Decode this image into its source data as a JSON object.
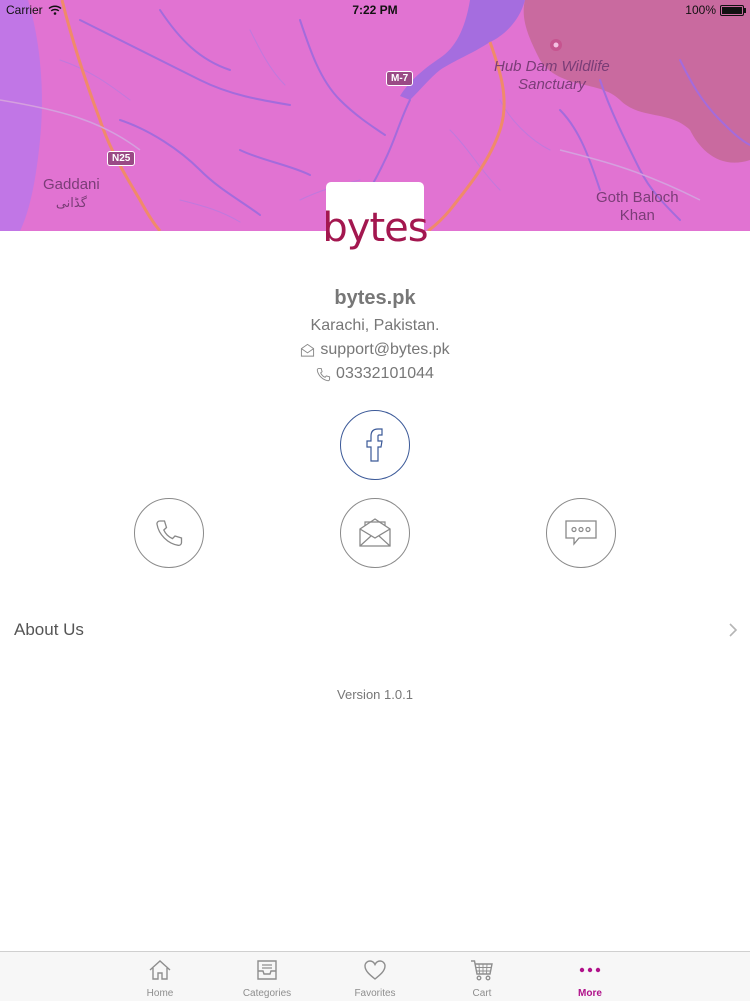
{
  "status_bar": {
    "carrier": "Carrier",
    "time": "7:22 PM",
    "battery": "100%"
  },
  "map": {
    "labels": {
      "gaddani": "Gaddani",
      "gaddani_urdu": "گڈانی",
      "hub_dam_line1": "Hub Dam Wildlife",
      "hub_dam_line2": "Sanctuary",
      "goth_line1": "Goth Baloch",
      "goth_line2": "Khan",
      "m7": "M-7",
      "n25": "N25"
    }
  },
  "logo": {
    "text": "bytes",
    "color": "#a3174f"
  },
  "company": {
    "name": "bytes.pk",
    "location": "Karachi, Pakistan.",
    "email": "support@bytes.pk",
    "phone": "03332101044"
  },
  "actions": {
    "facebook_icon": "facebook-icon",
    "call_icon": "phone-icon",
    "email_icon": "envelope-icon",
    "message_icon": "message-icon"
  },
  "about": {
    "label": "About Us"
  },
  "version": "Version 1.0.1",
  "tabs": [
    {
      "label": "Home",
      "icon": "home-icon",
      "active": false
    },
    {
      "label": "Categories",
      "icon": "tray-icon",
      "active": false
    },
    {
      "label": "Favorites",
      "icon": "heart-icon",
      "active": false
    },
    {
      "label": "Cart",
      "icon": "cart-icon",
      "active": false
    },
    {
      "label": "More",
      "icon": "more-icon",
      "active": true
    }
  ],
  "colors": {
    "accent": "#b0128a",
    "map_bg": "#e173d2",
    "facebook": "#3b5998"
  }
}
